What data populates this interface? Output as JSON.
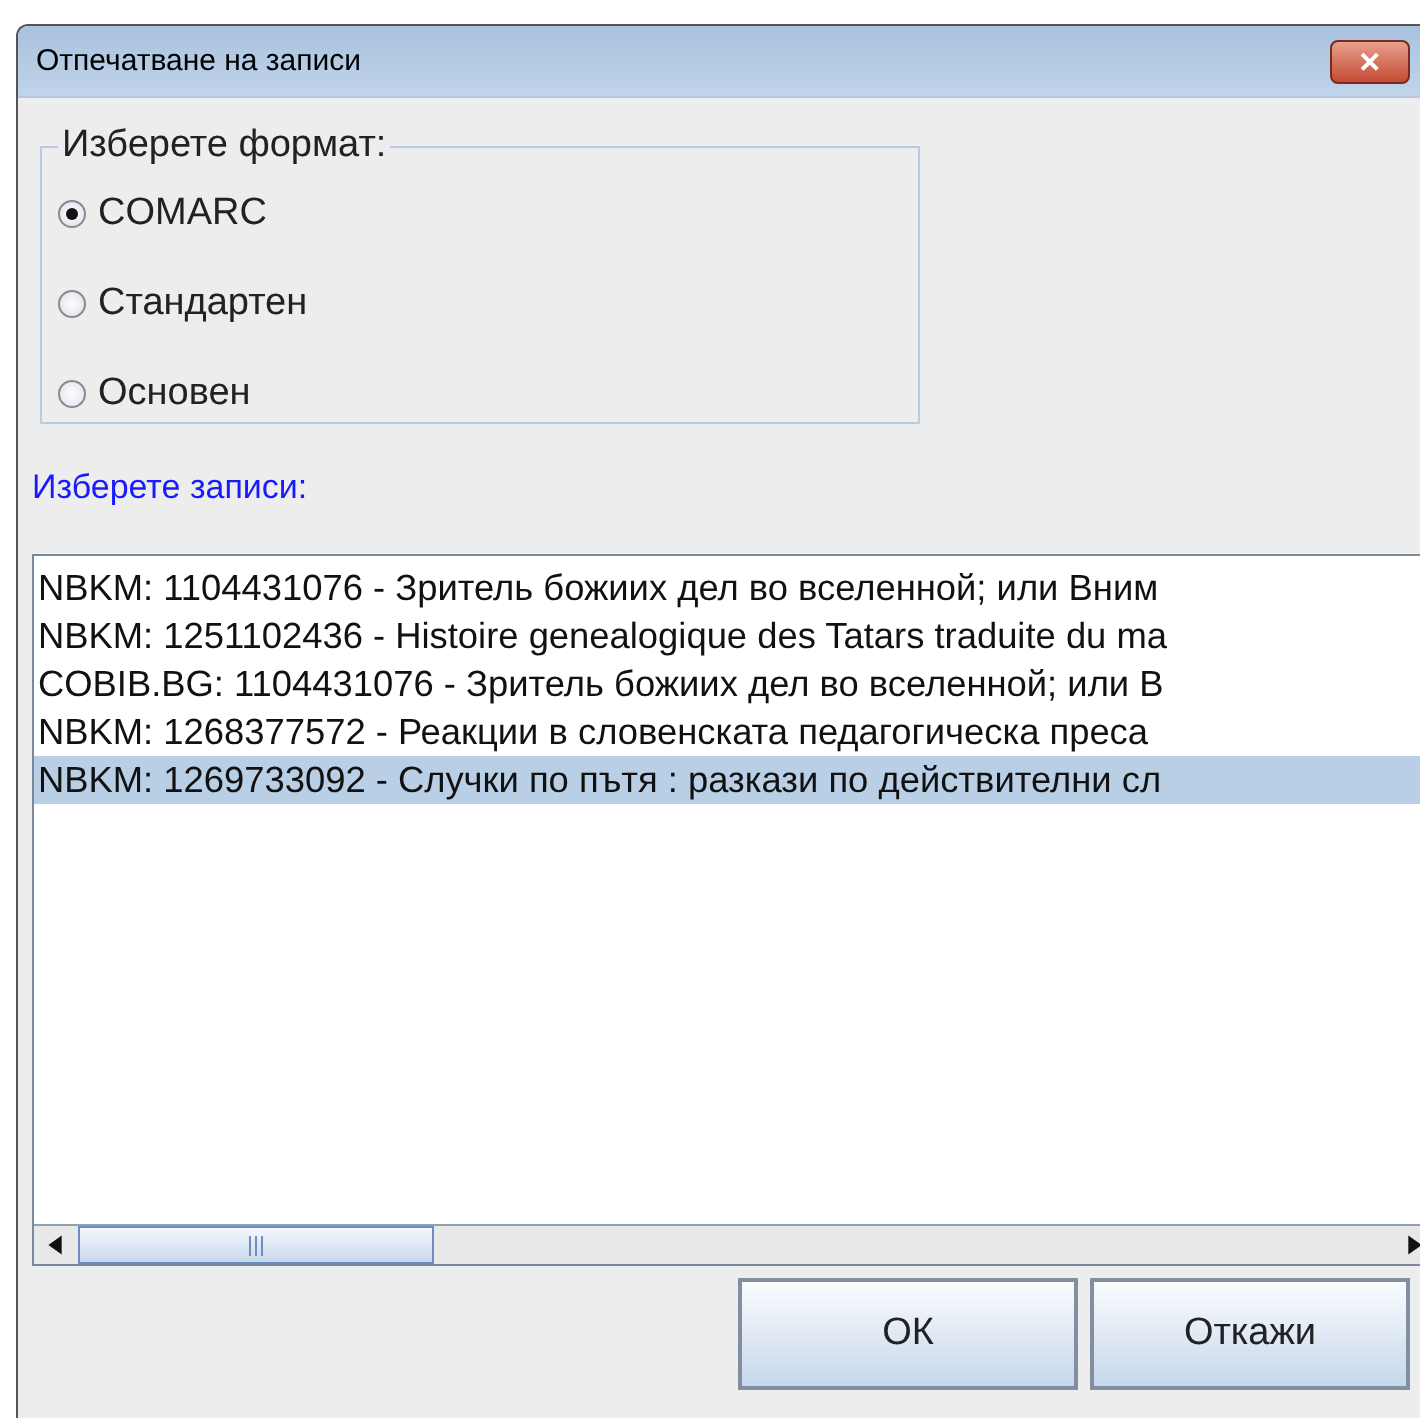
{
  "window": {
    "title": "Отпечатване на записи",
    "close": "✕"
  },
  "format": {
    "legend": "Изберете формат:",
    "options": [
      {
        "label": "COMARC",
        "selected": true
      },
      {
        "label": "Стандартен",
        "selected": false
      },
      {
        "label": "Основен",
        "selected": false
      }
    ]
  },
  "records": {
    "label": "Изберете записи:",
    "rows": [
      {
        "text": "NBKM: 1104431076 - Зритель божиих дел во вселенной; или Вним",
        "selected": false
      },
      {
        "text": "NBKM: 1251102436 - Histoire genealogique des Tatars traduite du ma",
        "selected": false
      },
      {
        "text": "COBIB.BG: 1104431076 - Зритель божиих дел во вселенной; или В",
        "selected": false
      },
      {
        "text": "NBKM: 1268377572 - Реакции в словенската педагогическа преса",
        "selected": false
      },
      {
        "text": "NBKM: 1269733092 - Случки по пътя : разкази по действителни сл",
        "selected": true
      }
    ]
  },
  "buttons": [
    "ОК",
    "Откажи"
  ]
}
